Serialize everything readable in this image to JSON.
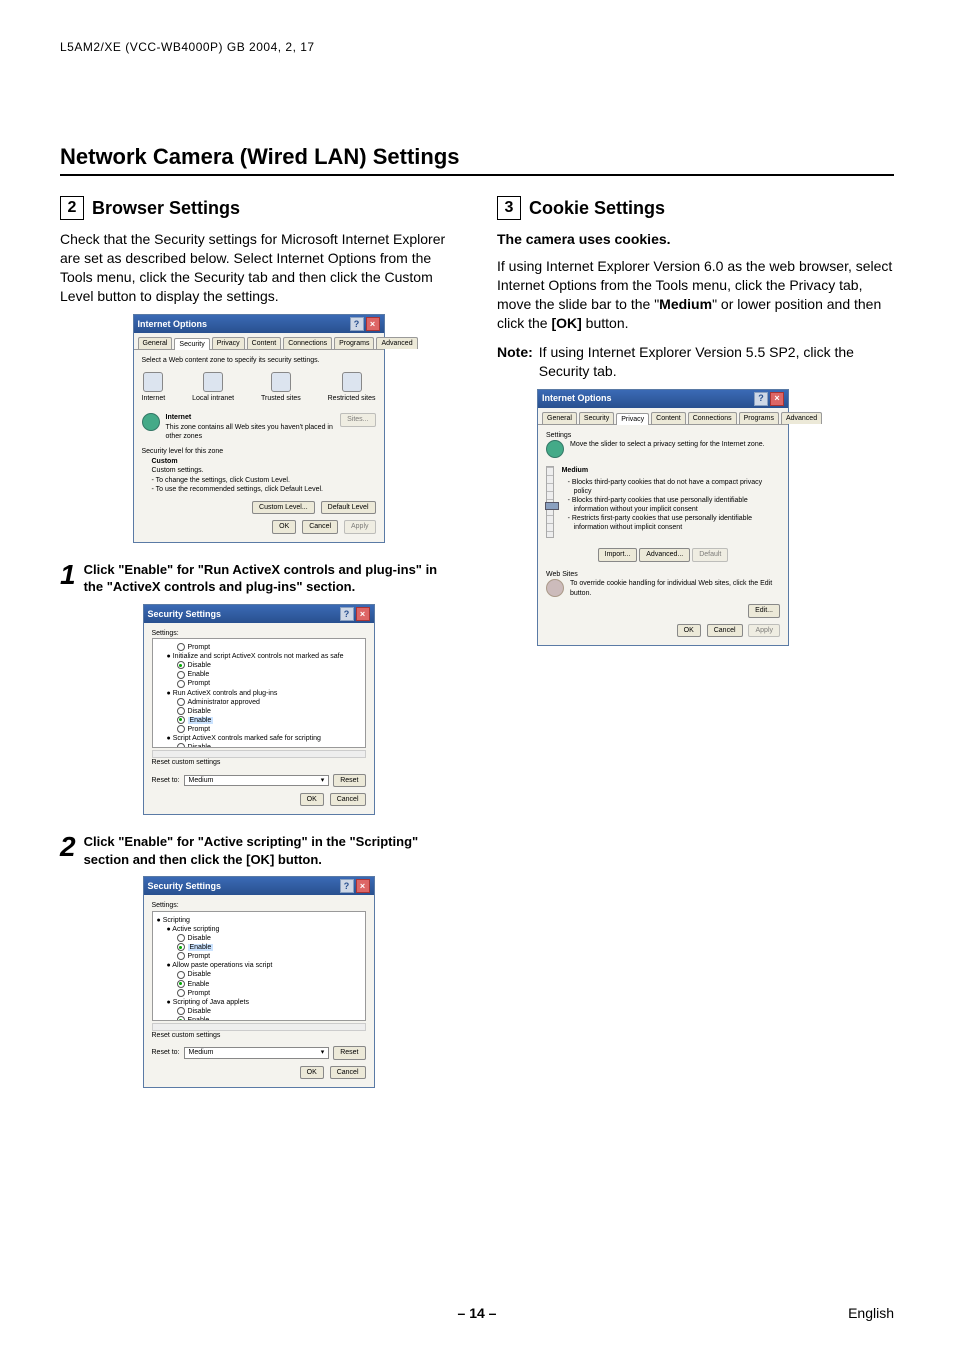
{
  "doc_header": "L5AM2/XE (VCC-WB4000P)    GB    2004, 2, 17",
  "page_title": "Network Camera (Wired LAN) Settings",
  "left": {
    "section_number": "2",
    "section_title": "Browser Settings",
    "intro": "Check that the Security settings for Microsoft Internet Explorer are set as described below. Select Internet Options from the Tools menu, click the Security tab and then click the Custom Level button to display the settings.",
    "step1_num": "1",
    "step1_text": "Click \"Enable\" for \"Run ActiveX controls and plug-ins\" in the \"ActiveX controls and plug-ins\" section.",
    "step2_num": "2",
    "step2_text": "Click \"Enable\" for \"Active scripting\" in the \"Scripting\" section and then click the [OK] button."
  },
  "right": {
    "section_number": "3",
    "section_title": "Cookie Settings",
    "sub_bold": "The camera uses cookies.",
    "intro_a": "If using Internet Explorer Version 6.0 as the web browser, select Internet Options from the Tools menu, click the Privacy tab, move the slide bar to the \"",
    "intro_medium": "Medium",
    "intro_b": "\" or lower position and then click the ",
    "intro_ok": "[OK]",
    "intro_c": " button.",
    "note_label": "Note:",
    "note_text": "If using Internet Explorer Version 5.5 SP2, click the Security tab."
  },
  "dlg": {
    "internet_options_title": "Internet Options",
    "security_settings_title": "Security Settings",
    "tabs": {
      "general": "General",
      "security": "Security",
      "privacy": "Privacy",
      "content": "Content",
      "connections": "Connections",
      "programs": "Programs",
      "advanced": "Advanced"
    },
    "zone_instruction": "Select a Web content zone to specify its security settings.",
    "zones": {
      "internet": "Internet",
      "local": "Local intranet",
      "trusted": "Trusted sites",
      "restricted": "Restricted sites"
    },
    "internet_label": "Internet",
    "internet_desc": "This zone contains all Web sites you haven't placed in other zones",
    "sites_btn": "Sites...",
    "sec_level_label": "Security level for this zone",
    "custom_label": "Custom",
    "custom_line1": "Custom settings.",
    "custom_line2": "- To change the settings, click Custom Level.",
    "custom_line3": "- To use the recommended settings, click Default Level.",
    "custom_level_btn": "Custom Level...",
    "default_level_btn": "Default Level",
    "ok_btn": "OK",
    "cancel_btn": "Cancel",
    "apply_btn": "Apply",
    "settings_label": "Settings:",
    "r_prompt": "Prompt",
    "r_disable": "Disable",
    "r_enable": "Enable",
    "ax_init": "Initialize and script ActiveX controls not marked as safe",
    "ax_run": "Run ActiveX controls and plug-ins",
    "ax_admin": "Administrator approved",
    "ax_script": "Script ActiveX controls marked safe for scripting",
    "scripting": "Scripting",
    "active_scripting": "Active scripting",
    "allow_paste": "Allow paste operations via script",
    "scripting_java": "Scripting of Java applets",
    "reset_custom": "Reset custom settings",
    "reset_to": "Reset to:",
    "medium": "Medium",
    "reset_btn": "Reset",
    "privacy_settings_label": "Settings",
    "privacy_move": "Move the slider to select a privacy setting for the Internet zone.",
    "privacy_medium": "Medium",
    "priv_b1": "Blocks third-party cookies that do not have a compact privacy policy",
    "priv_b2": "Blocks third-party cookies that use personally identifiable information without your implicit consent",
    "priv_b3": "Restricts first-party cookies that use personally identifiable information without implicit consent",
    "import_btn": "Import...",
    "advanced_btn": "Advanced...",
    "default_btn": "Default",
    "web_sites": "Web Sites",
    "web_sites_text": "To override cookie handling for individual Web sites, click the Edit button.",
    "edit_btn": "Edit..."
  },
  "footer": {
    "page": "– 14 –",
    "lang": "English"
  }
}
